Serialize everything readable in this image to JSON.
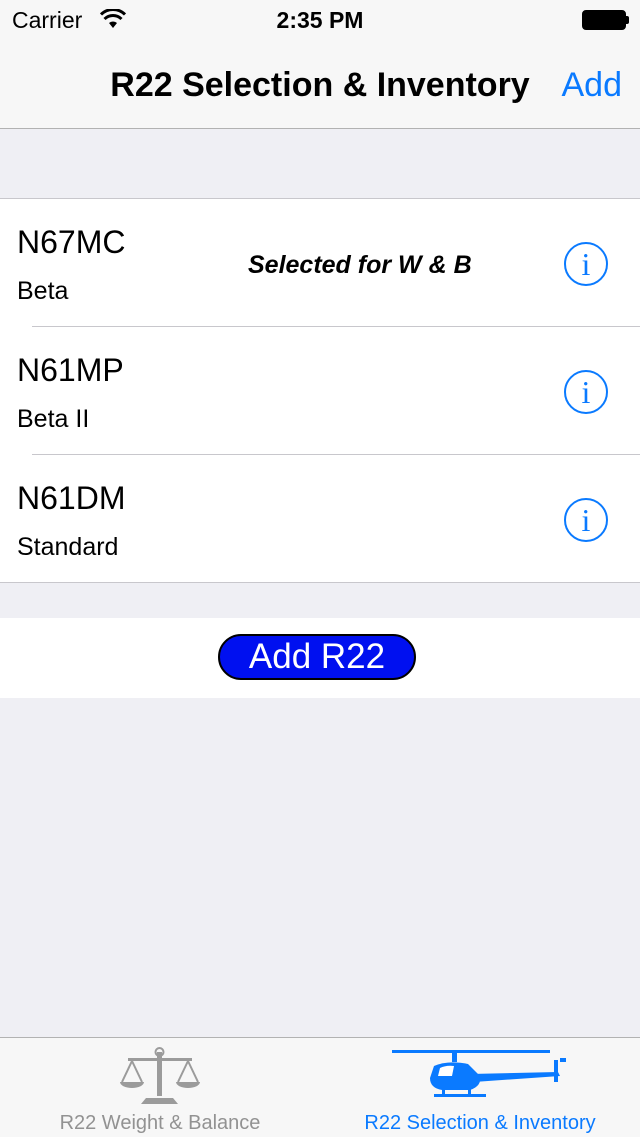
{
  "status_bar": {
    "carrier": "Carrier",
    "time": "2:35 PM",
    "icons": [
      "wifi-icon",
      "battery-icon"
    ]
  },
  "nav": {
    "title": "R22 Selection & Inventory",
    "add_label": "Add"
  },
  "aircraft": [
    {
      "registration": "N67MC",
      "model": "Beta",
      "status": "Selected for W & B"
    },
    {
      "registration": "N61MP",
      "model": "Beta II",
      "status": ""
    },
    {
      "registration": "N61DM",
      "model": "Standard",
      "status": ""
    }
  ],
  "info_glyph": "i",
  "add_button_label": "Add R22",
  "tabs": [
    {
      "label": "R22 Weight & Balance",
      "icon": "scale-icon",
      "selected": false
    },
    {
      "label": "R22 Selection & Inventory",
      "icon": "helicopter-icon",
      "selected": true
    }
  ],
  "colors": {
    "accent": "#0a7aff",
    "add_button": "#0010f0",
    "inactive_tab": "#929292"
  }
}
